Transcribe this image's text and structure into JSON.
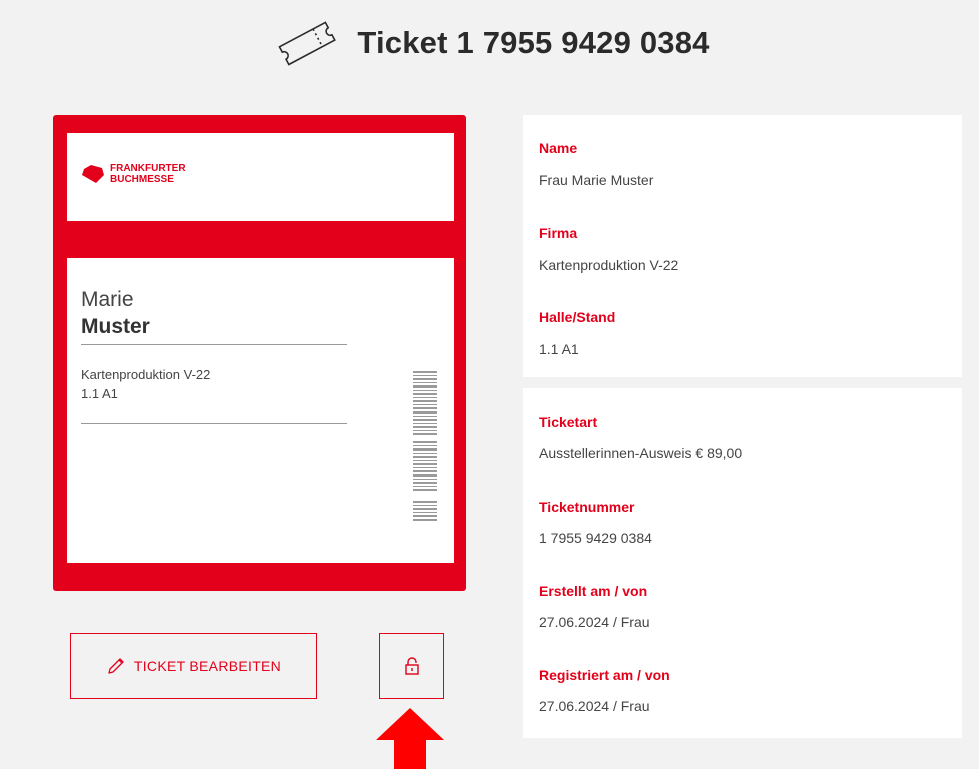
{
  "header": {
    "title": "Ticket 1 7955 9429 0384",
    "icon": "ticket-icon"
  },
  "card": {
    "logo_line1": "FRANKFURTER",
    "logo_line2": "BUCHMESSE",
    "first_name": "Marie",
    "last_name": "Muster",
    "company": "Kartenproduktion V-22",
    "stand": "1.1 A1",
    "brand_color": "#e2001a"
  },
  "actions": {
    "edit_label": "TICKET BEARBEITEN",
    "edit_icon": "pencil-icon",
    "lock_icon": "lock-icon"
  },
  "details_personal": [
    {
      "label": "Name",
      "value": "Frau Marie Muster"
    },
    {
      "label": "Firma",
      "value": "Kartenproduktion V-22"
    },
    {
      "label": "Halle/Stand",
      "value": "1.1 A1"
    }
  ],
  "details_ticket": [
    {
      "label": "Ticketart",
      "value": "Ausstellerinnen-Ausweis € 89,00"
    },
    {
      "label": "Ticketnummer",
      "value": "1 7955 9429 0384"
    },
    {
      "label": "Erstellt am / von",
      "value": "27.06.2024 / Frau"
    },
    {
      "label": "Registriert am / von",
      "value": "27.06.2024 / Frau"
    }
  ]
}
